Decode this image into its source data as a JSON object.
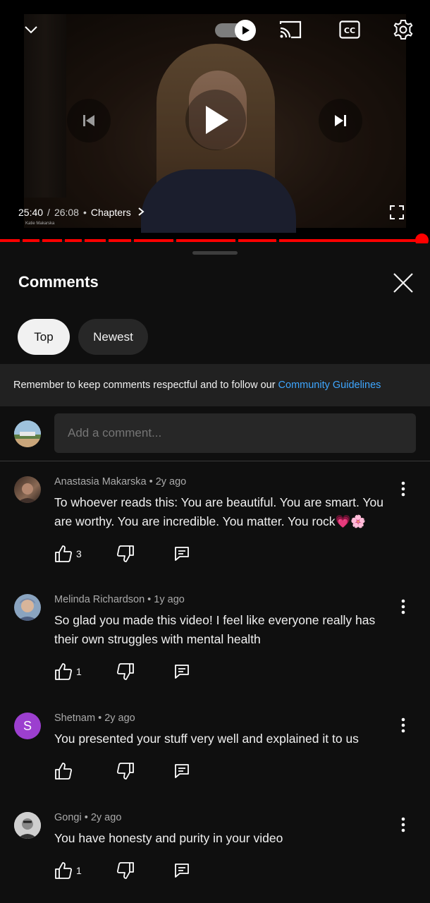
{
  "player": {
    "current_time": "25:40",
    "duration": "26:08",
    "separator": "/",
    "chapters_label": "Chapters",
    "watermark": "Katie Makarska",
    "autoplay_on": true,
    "progress_fraction": 0.982,
    "accent": "#ff0000",
    "icons": [
      "chevron-down-icon",
      "cast-icon",
      "captions-icon",
      "settings-icon",
      "previous-icon",
      "play-icon",
      "next-icon",
      "fullscreen-icon"
    ]
  },
  "comments": {
    "title": "Comments",
    "filters": [
      "Top",
      "Newest"
    ],
    "active_filter": "Top",
    "notice_text": "Remember to keep comments respectful and to follow our",
    "notice_link": "Community Guidelines",
    "add_placeholder": "Add a comment...",
    "items": [
      {
        "author": "Anastasia Makarska",
        "age": "2y ago",
        "text": "To whoever reads this: You are beautiful. You are smart. You are worthy. You are incredible. You matter. You rock💗🌸",
        "likes": "3"
      },
      {
        "author": "Melinda Richardson",
        "age": "1y ago",
        "text": "So glad you made this video! I feel like everyone really has their own struggles with mental health",
        "likes": "1"
      },
      {
        "author": "Shetnam",
        "age": "2y ago",
        "text": "You presented your stuff very well and explained it to us",
        "likes": "",
        "avatar_letter": "S",
        "avatar_color": "#9c3fcf"
      },
      {
        "author": "Gongi",
        "age": "2y ago",
        "text": "You have honesty and purity in your video",
        "likes": "1"
      }
    ]
  }
}
